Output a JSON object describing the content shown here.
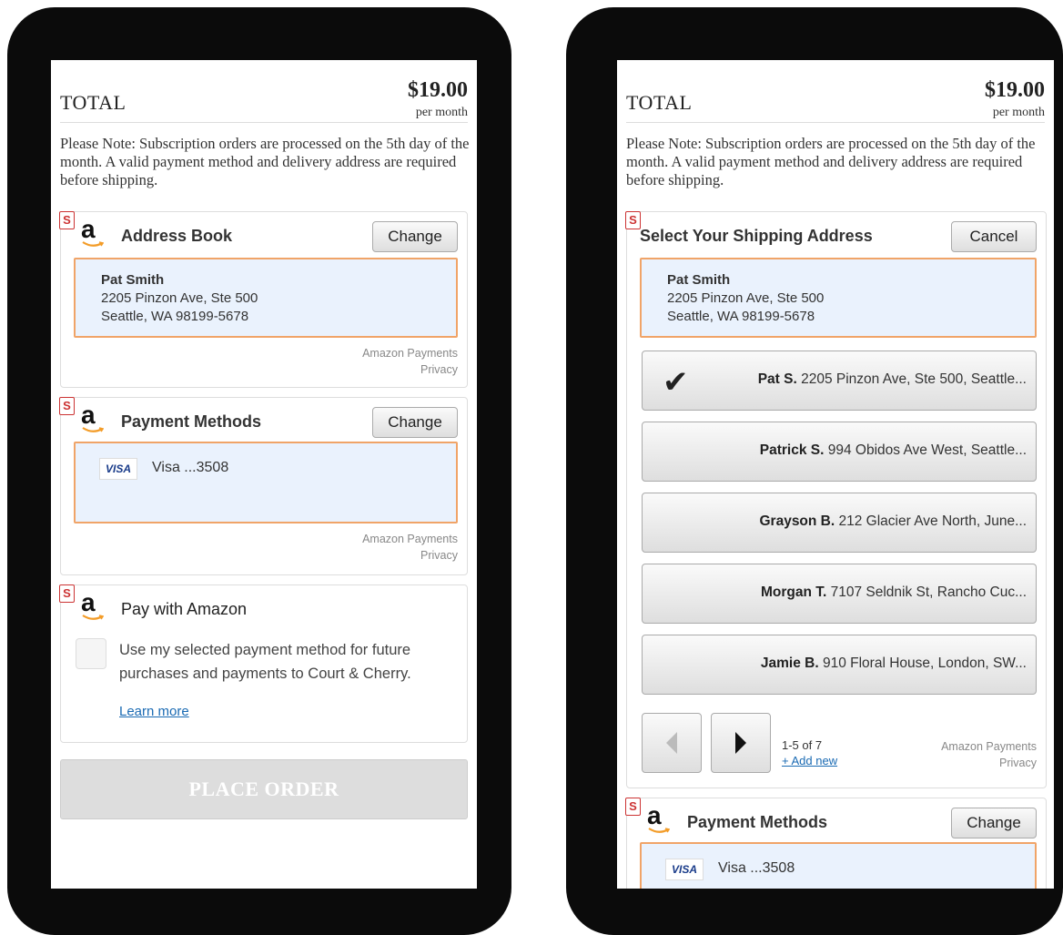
{
  "order": {
    "total_label": "TOTAL",
    "total_amount": "$19.00",
    "total_period": "per month",
    "note": "Please Note: Subscription orders are processed on the 5th day of the month. A valid payment method and delivery address are required before shipping."
  },
  "badge": "S",
  "left_screen": {
    "address_book": {
      "title": "Address Book",
      "change_label": "Change",
      "name": "Pat Smith",
      "line1": "2205 Pinzon Ave, Ste 500",
      "line2": "Seattle, WA 98199-5678",
      "footer_line1": "Amazon Payments",
      "footer_line2": "Privacy"
    },
    "payment_methods": {
      "title": "Payment Methods",
      "change_label": "Change",
      "card_brand": "VISA",
      "card_text": "Visa ...3508",
      "footer_line1": "Amazon Payments",
      "footer_line2": "Privacy"
    },
    "pay_with_amazon": {
      "title": "Pay with Amazon",
      "consent_text": "Use my selected payment method for future purchases and payments to Court & Cherry.",
      "learn_more": "Learn more"
    },
    "place_order_label": "PLACE ORDER"
  },
  "right_screen": {
    "shipping": {
      "title": "Select Your Shipping Address",
      "cancel_label": "Cancel",
      "name": "Pat Smith",
      "line1": "2205 Pinzon Ave, Ste 500",
      "line2": "Seattle, WA 98199-5678",
      "addresses": [
        {
          "name": "Pat S.",
          "address": "2205 Pinzon Ave, Ste 500, Seattle...",
          "selected": true
        },
        {
          "name": "Patrick S.",
          "address": "994 Obidos Ave West, Seattle...",
          "selected": false
        },
        {
          "name": "Grayson B.",
          "address": "212 Glacier Ave North, June...",
          "selected": false
        },
        {
          "name": "Morgan T.",
          "address": "7107 Seldnik St, Rancho Cuc...",
          "selected": false
        },
        {
          "name": "Jamie B.",
          "address": "910 Floral House, London, SW...",
          "selected": false
        }
      ],
      "page_count": "1-5 of 7",
      "add_new": "+ Add new",
      "footer_line1": "Amazon Payments",
      "footer_line2": "Privacy"
    },
    "payment_methods": {
      "title": "Payment Methods",
      "change_label": "Change",
      "card_brand": "VISA",
      "card_text": "Visa ...3508"
    }
  },
  "icons": {
    "amazon": "amazon-logo-icon",
    "check": "checkmark-icon",
    "prev": "chevron-left-icon",
    "next": "chevron-right-icon",
    "card": "visa-card-icon"
  },
  "colors": {
    "highlight_border": "#f0a468",
    "highlight_fill": "#eaf2fd",
    "link": "#1a6ab3",
    "badge": "#cc3333"
  }
}
